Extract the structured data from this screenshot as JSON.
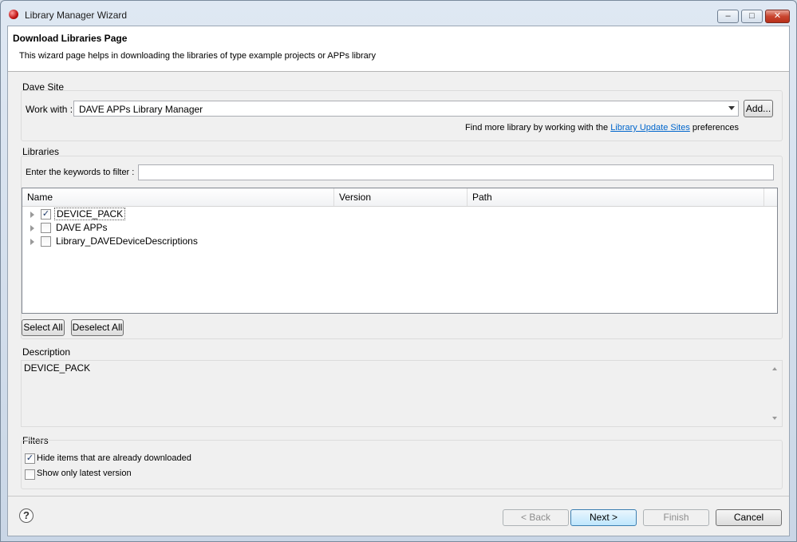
{
  "window": {
    "title": "Library Manager Wizard",
    "controls": {
      "minimize": "–",
      "maximize": "□",
      "close": "✕"
    }
  },
  "header": {
    "page_title": "Download Libraries Page",
    "description": "This wizard page helps in downloading the libraries of type example projects or APPs library"
  },
  "dave_site": {
    "group_label": "Dave Site",
    "work_with_label": "Work with :",
    "work_with_value": "DAVE APPs Library Manager",
    "add_label": "Add...",
    "hint_prefix": "Find more library by working with the ",
    "hint_link": "Library Update Sites",
    "hint_suffix": " preferences"
  },
  "libraries": {
    "group_label": "Libraries",
    "filter_label": "Enter the keywords to filter :",
    "filter_value": "",
    "columns": [
      "Name",
      "Version",
      "Path"
    ],
    "rows": [
      {
        "name": "DEVICE_PACK",
        "checked": true
      },
      {
        "name": "DAVE APPs",
        "checked": false
      },
      {
        "name": "Library_DAVEDeviceDescriptions",
        "checked": false
      }
    ],
    "select_all_label": "Select All",
    "deselect_all_label": "Deselect All"
  },
  "description": {
    "label": "Description",
    "text": "DEVICE_PACK"
  },
  "filters": {
    "label": "Filters",
    "hide_downloaded_label": "Hide items that are already downloaded",
    "hide_downloaded_checked": true,
    "latest_only_label": "Show only latest version",
    "latest_only_checked": false
  },
  "footer": {
    "help_glyph": "?",
    "back_label": "< Back",
    "next_label": "Next >",
    "finish_label": "Finish",
    "cancel_label": "Cancel"
  }
}
